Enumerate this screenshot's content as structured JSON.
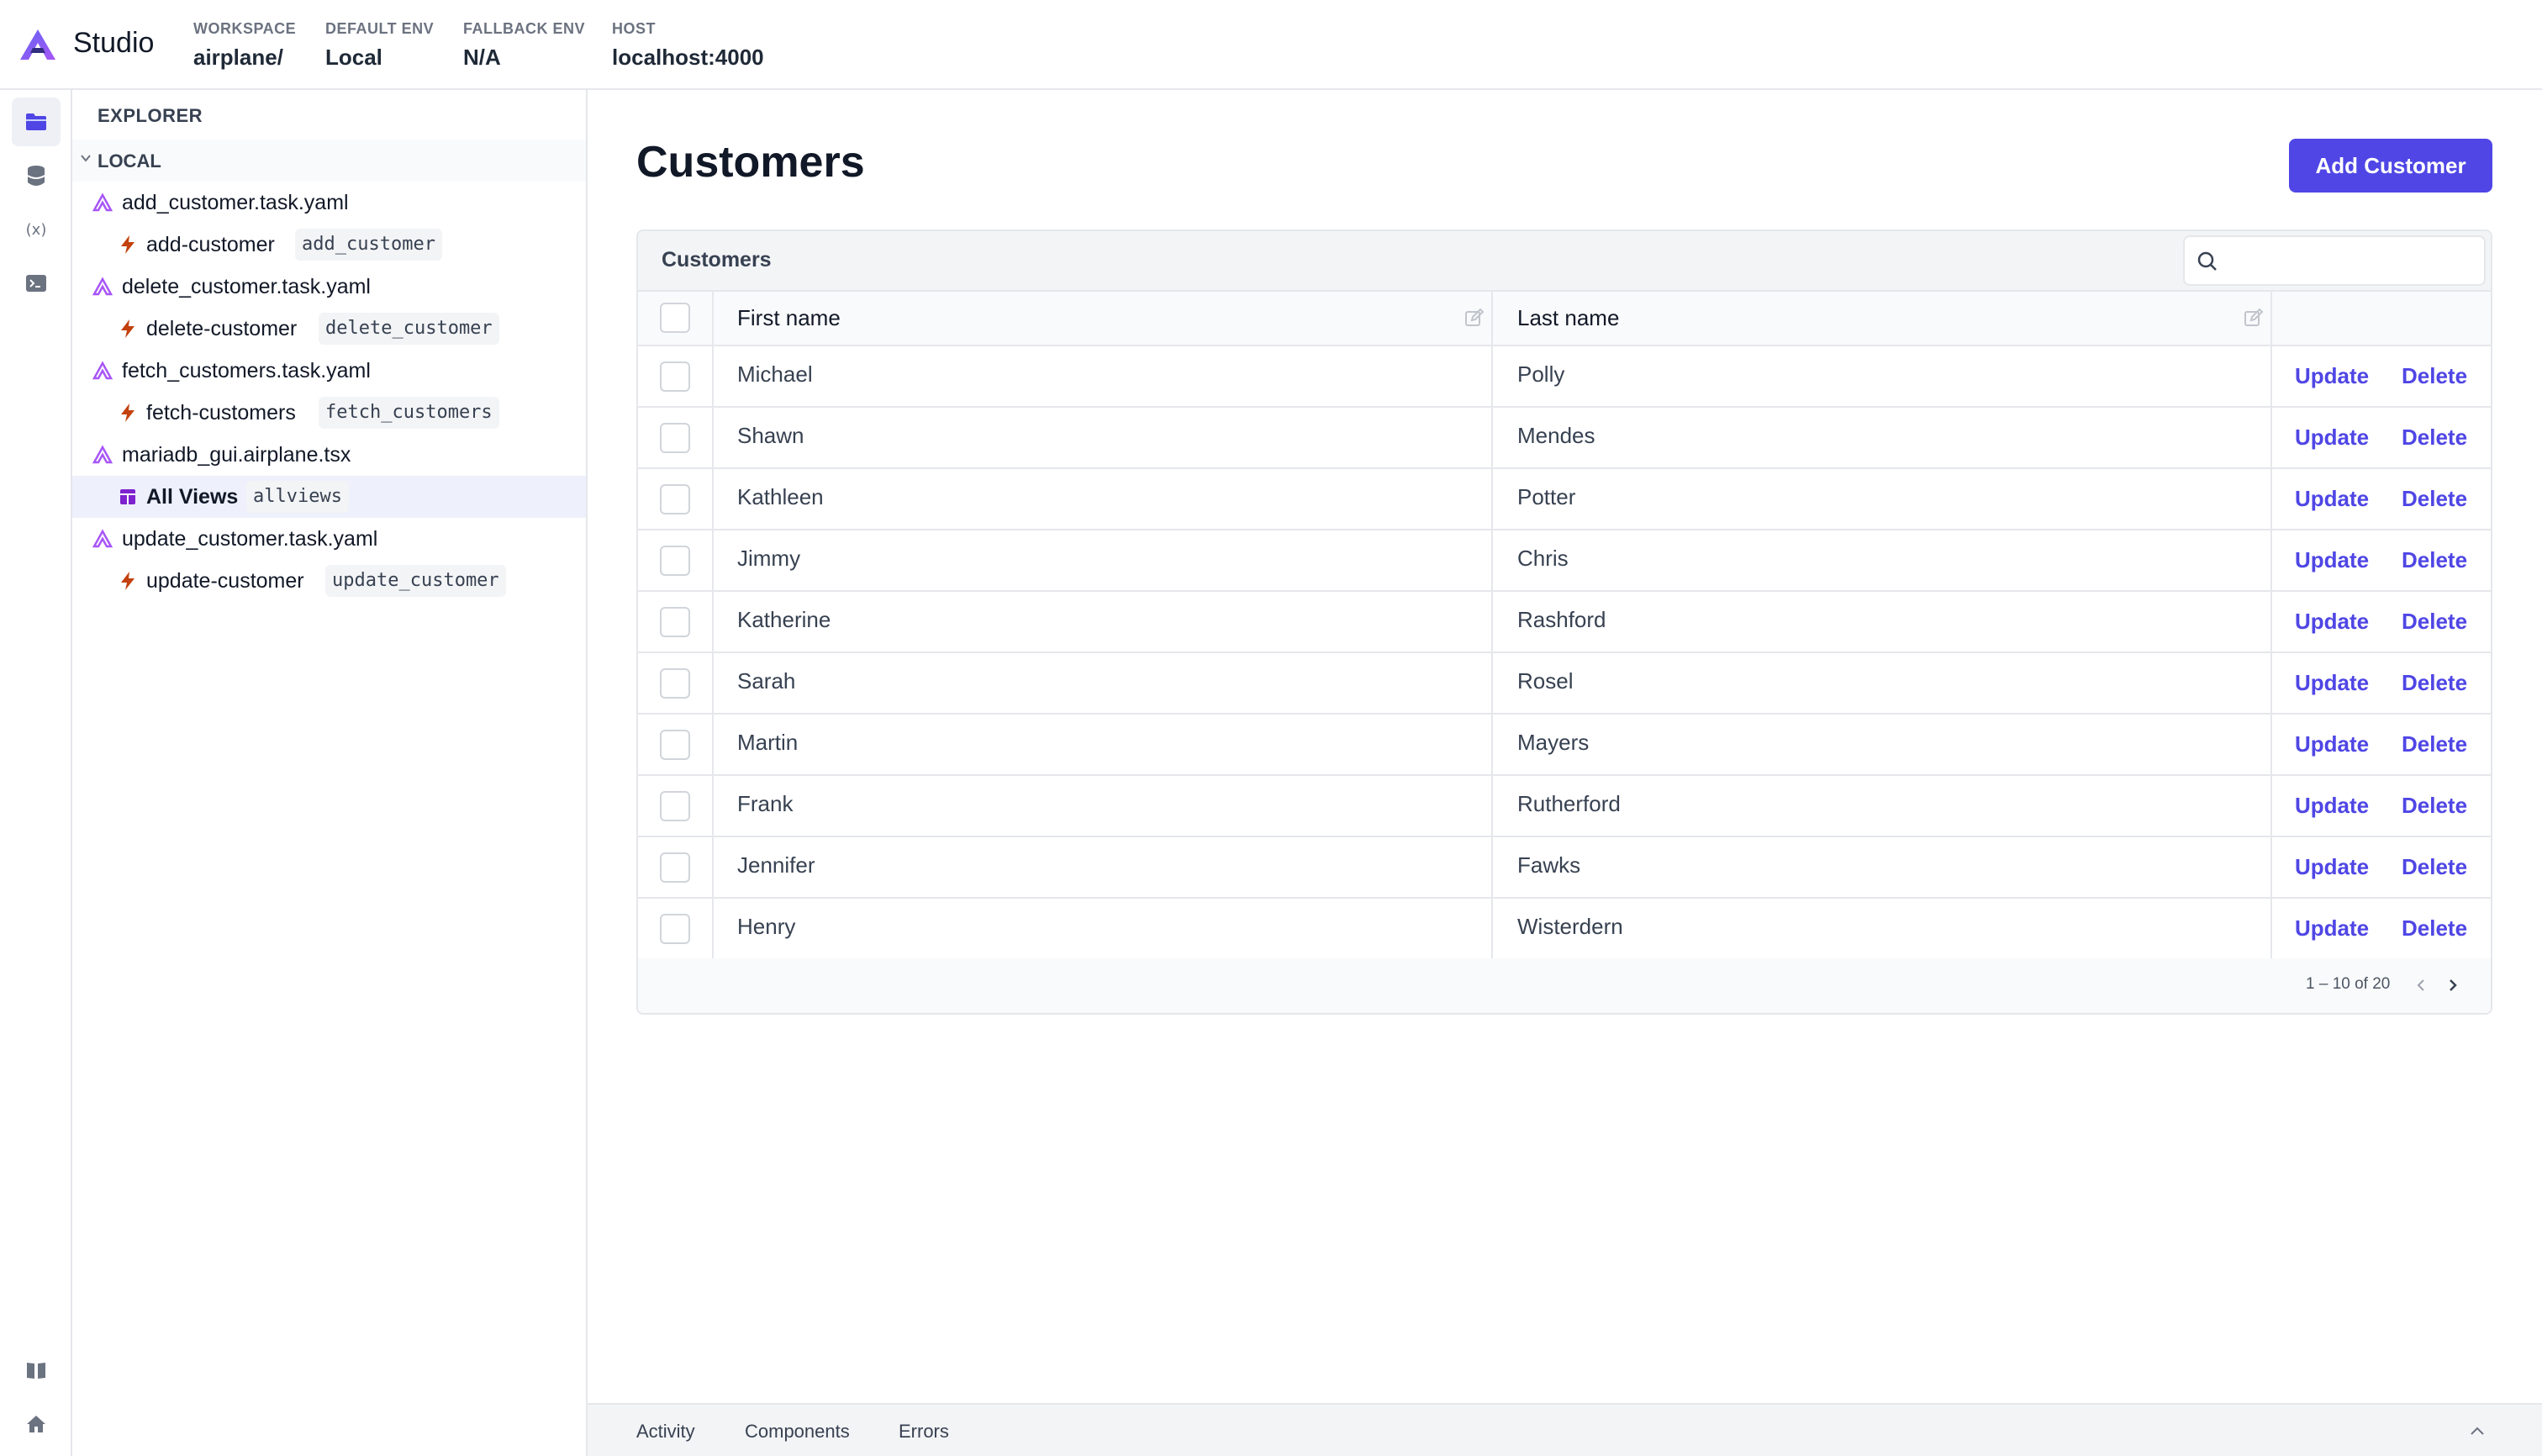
{
  "header": {
    "brand": "Studio",
    "workspace": {
      "label": "WORKSPACE",
      "value": "airplane/"
    },
    "default_env": {
      "label": "DEFAULT ENV",
      "value": "Local"
    },
    "fallback_env": {
      "label": "FALLBACK ENV",
      "value": "N/A"
    },
    "host": {
      "label": "HOST",
      "value": "localhost:4000"
    }
  },
  "rail": {
    "top": [
      "folder-icon",
      "database-icon",
      "variable-icon",
      "terminal-icon"
    ],
    "bottom": [
      "book-icon",
      "home-icon"
    ]
  },
  "explorer": {
    "title": "EXPLORER",
    "section": "LOCAL",
    "items": [
      {
        "file": "add_customer.task.yaml",
        "entry": "add-customer",
        "slug": "add_customer"
      },
      {
        "file": "delete_customer.task.yaml",
        "entry": "delete-customer",
        "slug": "delete_customer"
      },
      {
        "file": "fetch_customers.task.yaml",
        "entry": "fetch-customers",
        "slug": "fetch_customers"
      },
      {
        "file": "mariadb_gui.airplane.tsx",
        "entry": "All Views",
        "slug": "allviews"
      },
      {
        "file": "update_customer.task.yaml",
        "entry": "update-customer",
        "slug": "update_customer"
      }
    ]
  },
  "main": {
    "title": "Customers",
    "add_button": "Add Customer",
    "table": {
      "title": "Customers",
      "search_placeholder": "",
      "columns": [
        "First name",
        "Last name"
      ],
      "rows": [
        {
          "first": "Michael",
          "last": "Polly"
        },
        {
          "first": "Shawn",
          "last": "Mendes"
        },
        {
          "first": "Kathleen",
          "last": "Potter"
        },
        {
          "first": "Jimmy",
          "last": "Chris"
        },
        {
          "first": "Katherine",
          "last": "Rashford"
        },
        {
          "first": "Sarah",
          "last": "Rosel"
        },
        {
          "first": "Martin",
          "last": "Mayers"
        },
        {
          "first": "Frank",
          "last": "Rutherford"
        },
        {
          "first": "Jennifer",
          "last": "Fawks"
        },
        {
          "first": "Henry",
          "last": "Wisterdern"
        }
      ],
      "row_actions": {
        "update": "Update",
        "delete": "Delete"
      },
      "pagination": "1 – 10 of 20"
    }
  },
  "bottom_tabs": [
    "Activity",
    "Components",
    "Errors"
  ],
  "colors": {
    "accent": "#4f46e5",
    "task_icon": "#c2410c",
    "airplane_logo": "#a855f7"
  }
}
